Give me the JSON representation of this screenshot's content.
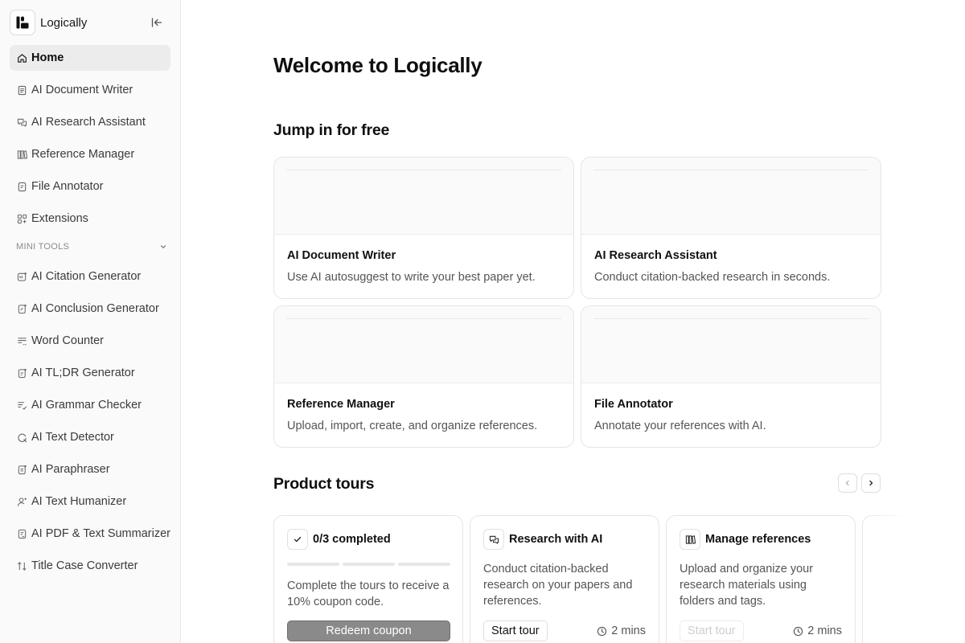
{
  "app": {
    "name": "Logically"
  },
  "sidebar": {
    "items": [
      {
        "label": "Home",
        "icon": "home-icon",
        "active": true
      },
      {
        "label": "AI Document Writer",
        "icon": "document-icon"
      },
      {
        "label": "AI Research Assistant",
        "icon": "chat-icon"
      },
      {
        "label": "Reference Manager",
        "icon": "library-icon"
      },
      {
        "label": "File Annotator",
        "icon": "file-icon"
      },
      {
        "label": "Extensions",
        "icon": "grid-icon"
      }
    ],
    "section_label": "MINI TOOLS",
    "tools": [
      {
        "label": "AI Citation Generator",
        "icon": "quote-icon"
      },
      {
        "label": "AI Conclusion Generator",
        "icon": "pen-file-icon"
      },
      {
        "label": "Word Counter",
        "icon": "text-count-icon"
      },
      {
        "label": "AI TL;DR Generator",
        "icon": "summary-icon"
      },
      {
        "label": "AI Grammar Checker",
        "icon": "grammar-icon"
      },
      {
        "label": "AI Text Detector",
        "icon": "search-scan-icon"
      },
      {
        "label": "AI Paraphraser",
        "icon": "rewrite-icon"
      },
      {
        "label": "AI Text Humanizer",
        "icon": "person-icon"
      },
      {
        "label": "AI PDF & Text Summarizer",
        "icon": "pdf-icon"
      },
      {
        "label": "Title Case Converter",
        "icon": "case-icon"
      }
    ]
  },
  "main": {
    "welcome": "Welcome to Logically",
    "jump_heading": "Jump in for free",
    "cards": [
      {
        "title": "AI Document Writer",
        "desc": "Use AI autosuggest to write your best paper yet."
      },
      {
        "title": "AI Research Assistant",
        "desc": "Conduct citation-backed research in seconds."
      },
      {
        "title": "Reference Manager",
        "desc": "Upload, import, create, and organize references."
      },
      {
        "title": "File Annotator",
        "desc": "Annotate your references with AI."
      }
    ],
    "tours_heading": "Product tours",
    "tours": [
      {
        "title": "0/3 completed",
        "body": "Complete the tours to receive a 10% coupon code.",
        "button": "Redeem coupon",
        "progress": 0,
        "steps": 3
      },
      {
        "title": "Research with AI",
        "body": "Conduct citation-backed research on your papers and references.",
        "button": "Start tour",
        "duration": "2 mins"
      },
      {
        "title": "Manage references",
        "body": "Upload and organize your research materials using folders and tags.",
        "button": "Start tour",
        "duration": "2 mins",
        "disabled": true
      }
    ]
  }
}
